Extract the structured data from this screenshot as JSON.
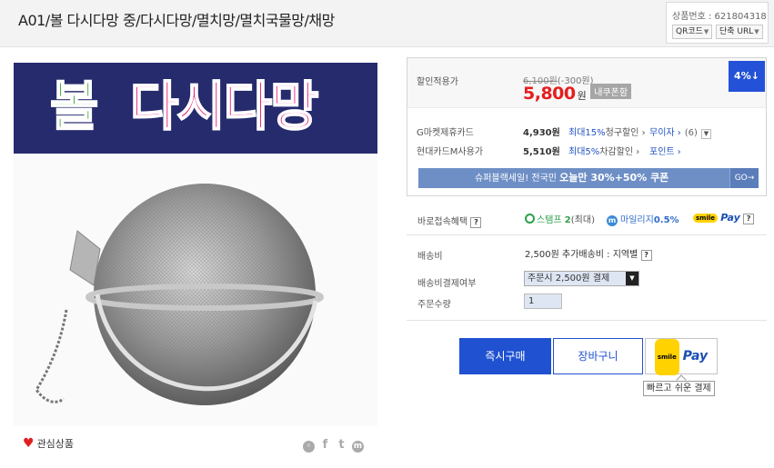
{
  "header": {
    "title": "A01/볼 다시다망 중/다시다망/멸치망/멸치국물망/채망",
    "product_no_label": "상품번호 : 621804318",
    "qr_label": "QR코드",
    "short_url_label": "단축 URL"
  },
  "image": {
    "banner_word_1": "볼",
    "banner_word_2": "다시다망"
  },
  "favorite": {
    "label": "관심상품"
  },
  "share": {
    "icons": [
      "share-icon",
      "facebook-icon",
      "twitter-icon",
      "messenger-icon"
    ]
  },
  "price": {
    "label": "할인적용가",
    "original": "6,100원",
    "discount_amount": "(-300원)",
    "sale": "5,800",
    "unit": "원",
    "coupon_tag": "내쿠폰함",
    "badge": "4%↓"
  },
  "cards": [
    {
      "label": "G마켓제휴카드",
      "value": "4,930원",
      "benefit": "최대15%",
      "benefit_suffix": "청구할인 ›",
      "extra": "무이자 ›",
      "extra_count": "(6)"
    },
    {
      "label": "현대카드M사용가",
      "value": "5,510원",
      "benefit": "최대5%",
      "benefit_suffix": "차감할인 ›",
      "extra": "포인트 ›"
    }
  ],
  "promo": {
    "prefix": "슈퍼블랙세일! 전국민 ",
    "highlight": "오늘만 30%+50% 쿠폰",
    "go": "GO→"
  },
  "benefits": {
    "label": "바로접속혜택",
    "stamp": "스탬프",
    "stamp_count": "2",
    "stamp_suffix": "(최대)",
    "mileage": "마일리지",
    "mileage_value": "0.5%",
    "smile_logo": "smile",
    "pay": "Pay"
  },
  "shipping": {
    "label": "배송비",
    "value": "2,500원 추가배송비 : 지역별",
    "payment_label": "배송비결제여부",
    "payment_selected": "주문시 2,500원 결제",
    "qty_label": "주문수량",
    "qty_value": "1"
  },
  "buttons": {
    "buy": "즉시구매",
    "cart": "장바구니",
    "smile_logo": "smile",
    "pay": "Pay",
    "tooltip": "빠르고 쉬운 결제"
  },
  "colors": {
    "accent": "#1f51d1",
    "sale_red": "#e61e1e",
    "promo": "#6e8fc5"
  }
}
